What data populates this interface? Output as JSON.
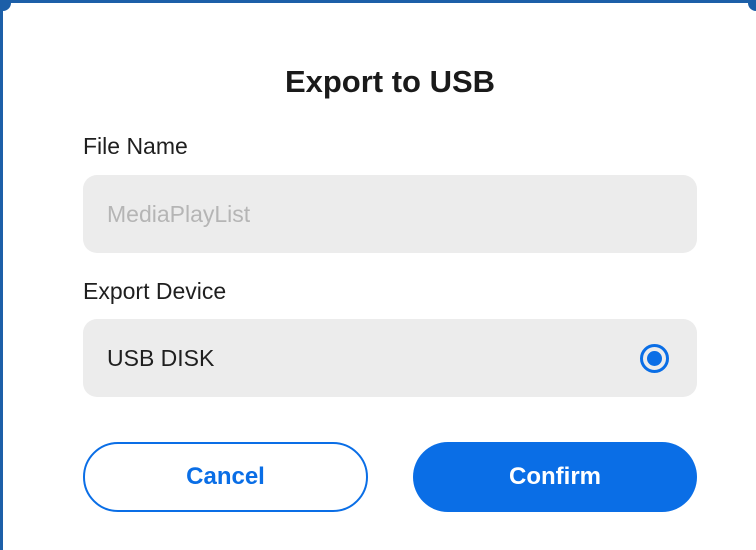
{
  "dialog": {
    "title": "Export to USB",
    "file_name": {
      "label": "File Name",
      "value": "",
      "placeholder": "MediaPlayList"
    },
    "export_device": {
      "label": "Export Device",
      "options": [
        {
          "label": "USB DISK",
          "selected": true
        }
      ]
    },
    "buttons": {
      "cancel_label": "Cancel",
      "confirm_label": "Confirm"
    }
  },
  "colors": {
    "accent": "#0a6ee6",
    "field_background": "#ececec",
    "frame": "#1c5fa8"
  },
  "icons": {
    "radio": "radio-selected-icon"
  }
}
